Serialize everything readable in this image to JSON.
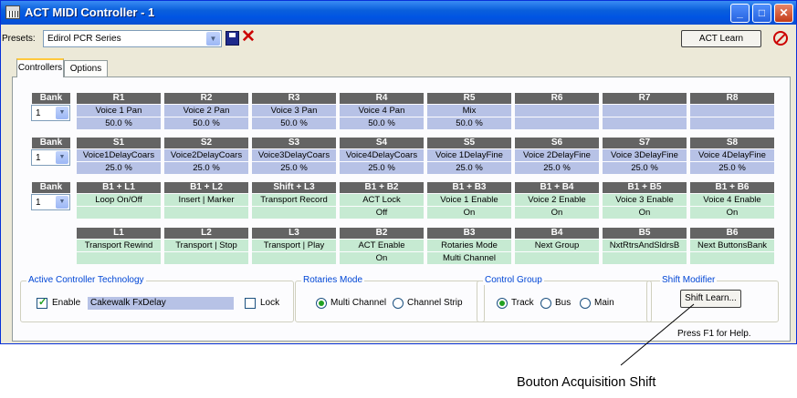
{
  "window": {
    "title": "ACT MIDI Controller - 1",
    "controls": {
      "minimize": "_",
      "maximize": "□",
      "close": "✕"
    }
  },
  "presets": {
    "label": "Presets:",
    "selected": "Edirol PCR Series",
    "act_learn": "ACT Learn"
  },
  "tabs": [
    "Controllers",
    "Options"
  ],
  "bank": {
    "label": "Bank",
    "value": "1"
  },
  "rows": [
    {
      "color": "blue",
      "controls": [
        {
          "header": "R1",
          "name": "Voice 1 Pan",
          "value": "50.0 %"
        },
        {
          "header": "R2",
          "name": "Voice 2 Pan",
          "value": "50.0 %"
        },
        {
          "header": "R3",
          "name": "Voice 3 Pan",
          "value": "50.0 %"
        },
        {
          "header": "R4",
          "name": "Voice 4 Pan",
          "value": "50.0 %"
        },
        {
          "header": "R5",
          "name": "Mix",
          "value": "50.0 %"
        },
        {
          "header": "R6",
          "name": "",
          "value": ""
        },
        {
          "header": "R7",
          "name": "",
          "value": ""
        },
        {
          "header": "R8",
          "name": "",
          "value": ""
        }
      ]
    },
    {
      "color": "blue",
      "controls": [
        {
          "header": "S1",
          "name": "Voice1DelayCoars",
          "value": "25.0 %"
        },
        {
          "header": "S2",
          "name": "Voice2DelayCoars",
          "value": "25.0 %"
        },
        {
          "header": "S3",
          "name": "Voice3DelayCoars",
          "value": "25.0 %"
        },
        {
          "header": "S4",
          "name": "Voice4DelayCoars",
          "value": "25.0 %"
        },
        {
          "header": "S5",
          "name": "Voice 1DelayFine",
          "value": "25.0 %"
        },
        {
          "header": "S6",
          "name": "Voice 2DelayFine",
          "value": "25.0 %"
        },
        {
          "header": "S7",
          "name": "Voice 3DelayFine",
          "value": "25.0 %"
        },
        {
          "header": "S8",
          "name": "Voice 4DelayFine",
          "value": "25.0 %"
        }
      ]
    },
    {
      "color": "green",
      "controls": [
        {
          "header": "B1 + L1",
          "name": "Loop On/Off",
          "value": ""
        },
        {
          "header": "B1 + L2",
          "name": "Insert | Marker",
          "value": ""
        },
        {
          "header": "Shift + L3",
          "name": "Transport Record",
          "value": ""
        },
        {
          "header": "B1 + B2",
          "name": "ACT Lock",
          "value": "Off"
        },
        {
          "header": "B1 + B3",
          "name": "Voice 1 Enable",
          "value": "On"
        },
        {
          "header": "B1 + B4",
          "name": "Voice 2 Enable",
          "value": "On"
        },
        {
          "header": "B1 + B5",
          "name": "Voice 3 Enable",
          "value": "On"
        },
        {
          "header": "B1 + B6",
          "name": "Voice 4 Enable",
          "value": "On"
        }
      ]
    },
    {
      "color": "green",
      "controls": [
        {
          "header": "L1",
          "name": "Transport Rewind",
          "value": ""
        },
        {
          "header": "L2",
          "name": "Transport | Stop",
          "value": ""
        },
        {
          "header": "L3",
          "name": "Transport | Play",
          "value": ""
        },
        {
          "header": "B2",
          "name": "ACT Enable",
          "value": "On"
        },
        {
          "header": "B3",
          "name": "Rotaries Mode",
          "value": "Multi Channel"
        },
        {
          "header": "B4",
          "name": "Next Group",
          "value": ""
        },
        {
          "header": "B5",
          "name": "NxtRtrsAndSldrsB",
          "value": ""
        },
        {
          "header": "B6",
          "name": "Next ButtonsBank",
          "value": ""
        }
      ]
    }
  ],
  "act": {
    "title": "Active Controller Technology",
    "enable_label": "Enable",
    "enable_checked": true,
    "plugin": "Cakewalk FxDelay",
    "lock_label": "Lock",
    "lock_checked": false
  },
  "rotaries": {
    "title": "Rotaries Mode",
    "options": [
      "Multi Channel",
      "Channel Strip"
    ],
    "selected": "Multi Channel"
  },
  "control_group": {
    "title": "Control Group",
    "options": [
      "Track",
      "Bus",
      "Main"
    ],
    "selected": "Track"
  },
  "shift": {
    "title": "Shift Modifier",
    "button": "Shift Learn...",
    "help": "Press F1 for Help."
  },
  "callout": "Bouton Acquisition Shift",
  "colors": {
    "header_bg": "#646464",
    "blue_cell": "#b7c2e6",
    "green_cell": "#c6ead2",
    "titlebar": "#0054e3",
    "group_title": "#0046d5"
  }
}
